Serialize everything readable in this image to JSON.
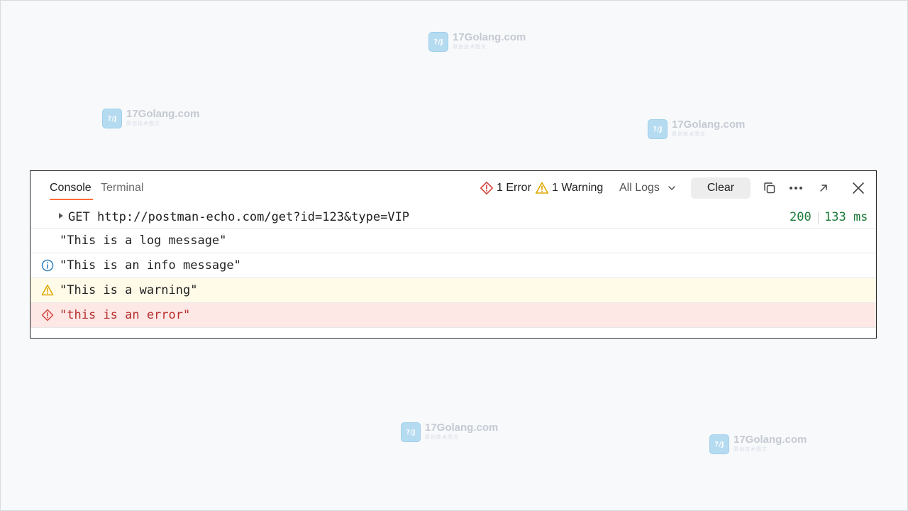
{
  "watermark": {
    "title": "17Golang.com",
    "subtitle": "原创技术图文",
    "logo_text": "?/J"
  },
  "console": {
    "tabs": [
      {
        "label": "Console",
        "active": true
      },
      {
        "label": "Terminal",
        "active": false
      }
    ],
    "error_count_label": "1 Error",
    "warning_count_label": "1 Warning",
    "filter_label": "All Logs",
    "clear_label": "Clear",
    "request": {
      "text": "GET http://postman-echo.com/get?id=123&type=VIP",
      "status": "200",
      "time": "133 ms"
    },
    "logs": [
      {
        "level": "log",
        "text": "\"This is a log message\""
      },
      {
        "level": "info",
        "text": "\"This is an info message\""
      },
      {
        "level": "warning",
        "text": "\"This is a warning\""
      },
      {
        "level": "error",
        "text": "\"this is an error\""
      }
    ]
  },
  "colors": {
    "accent": "#ff6c37",
    "status_ok": "#1d7b3a",
    "warning_icon": "#e0a800",
    "error_icon": "#d6453d",
    "info_icon": "#2f7fc1",
    "warning_bg": "#fffbe8",
    "error_bg": "#fde8e6"
  }
}
